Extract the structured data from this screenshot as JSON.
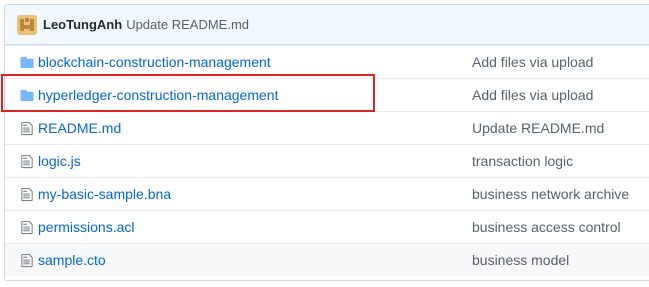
{
  "commit": {
    "author": "LeoTungAnh",
    "message": "Update README.md"
  },
  "files": [
    {
      "type": "folder",
      "icon": "folder-icon",
      "name": "blockchain-construction-management",
      "message": "Add files via upload"
    },
    {
      "type": "folder",
      "icon": "folder-icon",
      "name": "hyperledger-construction-management",
      "message": "Add files via upload"
    },
    {
      "type": "file",
      "icon": "file-icon",
      "name": "README.md",
      "message": "Update README.md"
    },
    {
      "type": "file",
      "icon": "file-icon",
      "name": "logic.js",
      "message": "transaction logic"
    },
    {
      "type": "file",
      "icon": "file-icon",
      "name": "my-basic-sample.bna",
      "message": "business network archive"
    },
    {
      "type": "file",
      "icon": "file-icon",
      "name": "permissions.acl",
      "message": "business access control"
    },
    {
      "type": "file",
      "icon": "file-icon",
      "name": "sample.cto",
      "message": "business model"
    }
  ],
  "highlight": {
    "target": "hyperledger-construction-management",
    "color": "#e02424"
  },
  "colors": {
    "link": "#0366d6",
    "folder_icon": "#79b8ff",
    "file_icon": "#6a737d",
    "header_bg": "#f1f8ff"
  }
}
